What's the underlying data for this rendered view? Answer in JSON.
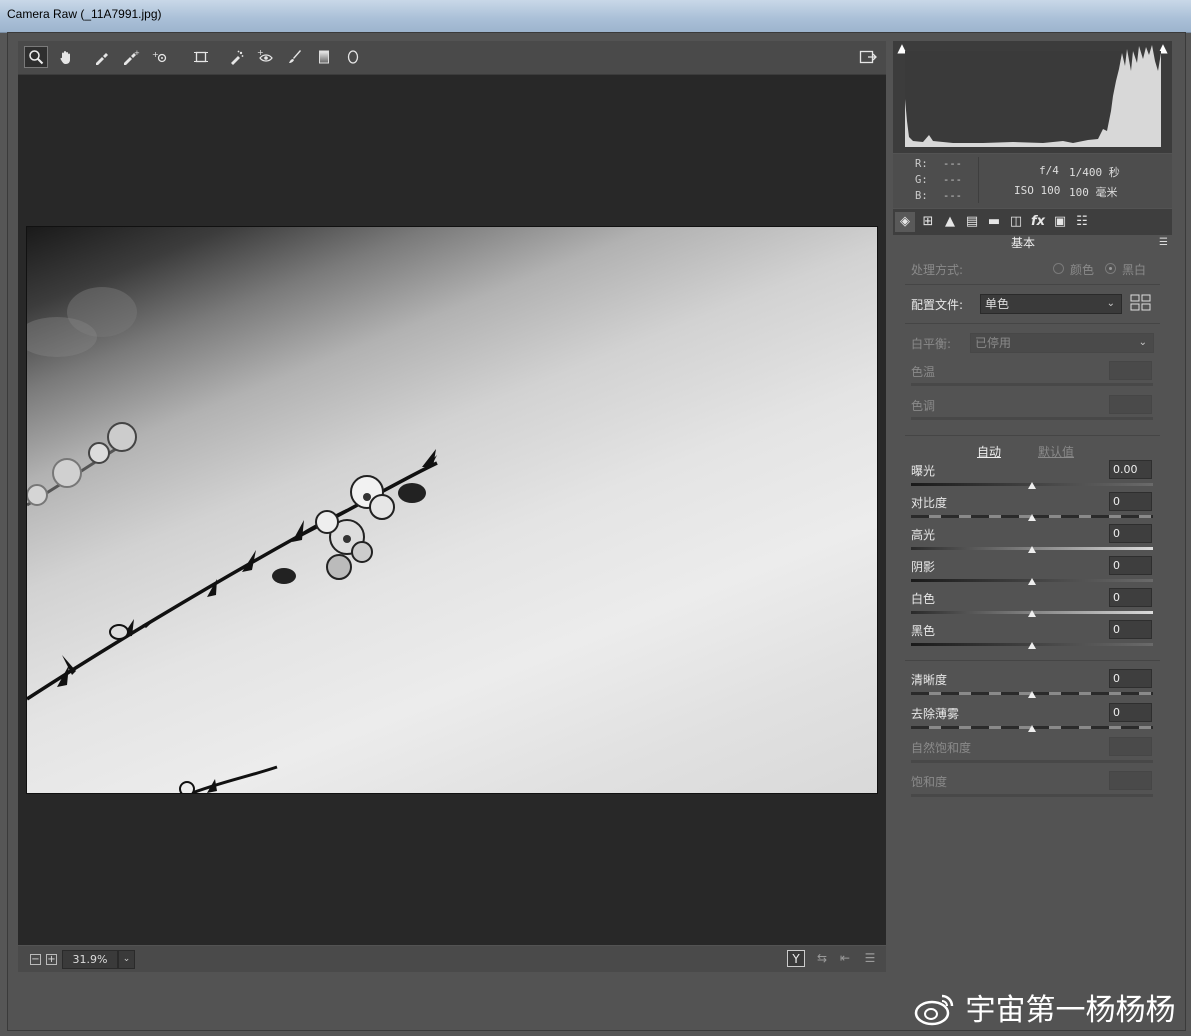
{
  "window": {
    "title": "Camera Raw (_11A7991.jpg)"
  },
  "toolbar": {
    "tools": [
      {
        "name": "zoom-tool",
        "glyph": "🔍"
      },
      {
        "name": "hand-tool",
        "glyph": "✋"
      },
      {
        "name": "white-balance-tool",
        "glyph": "✒"
      },
      {
        "name": "color-sampler-tool",
        "glyph": "✑"
      },
      {
        "name": "targeted-adjustment-tool",
        "glyph": "⊹"
      },
      {
        "name": "transform-tool",
        "glyph": "⌗"
      },
      {
        "name": "spot-removal-tool",
        "glyph": "✐"
      },
      {
        "name": "red-eye-tool",
        "glyph": "◉"
      },
      {
        "name": "adjustment-brush-tool",
        "glyph": "✎"
      },
      {
        "name": "graduated-filter-tool",
        "glyph": "▮"
      },
      {
        "name": "radial-filter-tool",
        "glyph": "◯"
      }
    ],
    "fullscreen_glyph": "⇱"
  },
  "zoom": {
    "minus": "−",
    "plus": "+",
    "value": "31.9%",
    "dropdown": "⌄"
  },
  "bottom_icons": {
    "yview": "Y",
    "swap": "⇆",
    "copy": "⇤",
    "settings": "☰"
  },
  "histogram": {
    "shadow_clip": "▲",
    "highlight_clip": "▲"
  },
  "readout": {
    "r_label": "R:",
    "g_label": "G:",
    "b_label": "B:",
    "r_value": "---",
    "g_value": "---",
    "b_value": "---",
    "aperture": "f/4",
    "shutter": "1/400 秒",
    "iso": "ISO 100",
    "focal": "100 毫米"
  },
  "panel_tabs": [
    {
      "name": "basic-tab",
      "glyph": "◈"
    },
    {
      "name": "tone-curve-tab",
      "glyph": "⊞"
    },
    {
      "name": "detail-tab",
      "glyph": "▲"
    },
    {
      "name": "hsl-tab",
      "glyph": "▤"
    },
    {
      "name": "split-toning-tab",
      "glyph": "▬"
    },
    {
      "name": "lens-tab",
      "glyph": "◫"
    },
    {
      "name": "effects-tab",
      "glyph": "fx"
    },
    {
      "name": "calibration-tab",
      "glyph": "▣"
    },
    {
      "name": "presets-tab",
      "glyph": "☷"
    }
  ],
  "panel": {
    "title": "基本",
    "menu_glyph": "☰",
    "treatment_label": "处理方式:",
    "color_label": "颜色",
    "bw_label": "黑白",
    "profile_label": "配置文件:",
    "profile_value": "单色",
    "profile_browser_glyph": "⊞",
    "wb_label": "白平衡:",
    "wb_value": "已停用",
    "temp_label": "色温",
    "tint_label": "色调",
    "auto_label": "自动",
    "default_label": "默认值",
    "sliders": [
      {
        "label": "曝光",
        "value": "0.00"
      },
      {
        "label": "对比度",
        "value": "0"
      },
      {
        "label": "高光",
        "value": "0"
      },
      {
        "label": "阴影",
        "value": "0"
      },
      {
        "label": "白色",
        "value": "0"
      },
      {
        "label": "黑色",
        "value": "0"
      }
    ],
    "presence": [
      {
        "label": "清晰度",
        "value": "0"
      },
      {
        "label": "去除薄雾",
        "value": "0"
      }
    ],
    "disabled": [
      {
        "label": "自然饱和度"
      },
      {
        "label": "饱和度"
      }
    ]
  },
  "watermark": "宇宙第一杨杨杨",
  "colors": {
    "preview_bg": "#282828",
    "panel_bg": "#535353",
    "link": "#8ab4e8"
  }
}
